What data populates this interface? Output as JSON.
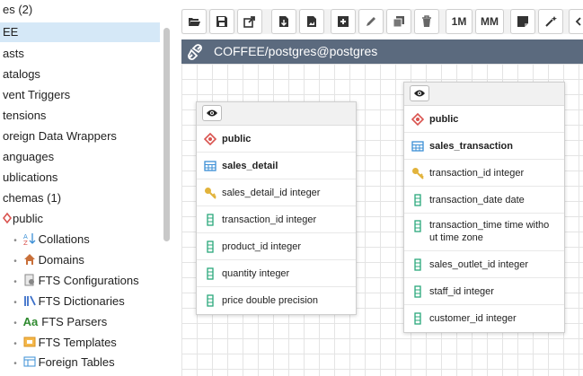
{
  "sidebar": {
    "items": [
      {
        "label": "es (2)",
        "icon": "none",
        "selected": false
      },
      {
        "label": "EE",
        "icon": "none",
        "selected": true
      },
      {
        "label": "asts",
        "icon": "none",
        "selected": false
      },
      {
        "label": "atalogs",
        "icon": "none",
        "selected": false
      },
      {
        "label": "vent Triggers",
        "icon": "none",
        "selected": false
      },
      {
        "label": "tensions",
        "icon": "none",
        "selected": false
      },
      {
        "label": "oreign Data Wrappers",
        "icon": "none",
        "selected": false
      },
      {
        "label": "anguages",
        "icon": "none",
        "selected": false
      },
      {
        "label": "ublications",
        "icon": "none",
        "selected": false
      },
      {
        "label": "chemas (1)",
        "icon": "none",
        "selected": false
      },
      {
        "label": "public",
        "icon": "schema-icon",
        "selected": false
      },
      {
        "label": "Collations",
        "icon": "collation-icon",
        "selected": false
      },
      {
        "label": "Domains",
        "icon": "domain-icon",
        "selected": false
      },
      {
        "label": "FTS Configurations",
        "icon": "fts-config-icon",
        "selected": false
      },
      {
        "label": "FTS Dictionaries",
        "icon": "fts-dictionary-icon",
        "selected": false
      },
      {
        "label": "FTS Parsers",
        "icon": "fts-parser-icon",
        "selected": false
      },
      {
        "label": "FTS Templates",
        "icon": "fts-template-icon",
        "selected": false
      },
      {
        "label": "Foreign Tables",
        "icon": "foreign-table-icon",
        "selected": false
      }
    ],
    "fts_parser_prefix": "Aa"
  },
  "toolbar": {
    "buttons": [
      {
        "name": "open-file-button",
        "icon": "folder-open-icon"
      },
      {
        "name": "save-button",
        "icon": "save-icon"
      },
      {
        "name": "save-as-button",
        "icon": "save-as-icon"
      },
      {
        "name": "export-sql-button",
        "icon": "export-sql-icon"
      },
      {
        "name": "download-image-button",
        "icon": "download-image-icon"
      },
      {
        "name": "add-table-button",
        "icon": "add-table-icon"
      },
      {
        "name": "edit-table-button",
        "icon": "pencil-icon"
      },
      {
        "name": "clone-table-button",
        "icon": "clone-icon"
      },
      {
        "name": "delete-button",
        "icon": "trash-icon"
      },
      {
        "name": "one-to-many-button",
        "label": "1M"
      },
      {
        "name": "many-to-many-button",
        "label": "MM"
      },
      {
        "name": "add-note-button",
        "icon": "note-icon"
      },
      {
        "name": "auto-align-button",
        "icon": "magic-wand-icon"
      }
    ]
  },
  "canvas": {
    "title": "COFFEE/postgres@postgres",
    "header_color": "#5b6a7e",
    "tables": [
      {
        "schema": "public",
        "name": "sales_detail",
        "columns": [
          {
            "text": "sales_detail_id integer",
            "key": "primary"
          },
          {
            "text": "transaction_id integer",
            "key": "none"
          },
          {
            "text": "product_id integer",
            "key": "none"
          },
          {
            "text": "quantity integer",
            "key": "none"
          },
          {
            "text": "price double precision",
            "key": "none"
          }
        ]
      },
      {
        "schema": "public",
        "name": "sales_transaction",
        "columns": [
          {
            "text": "transaction_id integer",
            "key": "primary"
          },
          {
            "text": "transaction_date date",
            "key": "none"
          },
          {
            "text": "transaction_time time witho ut time zone",
            "key": "none"
          },
          {
            "text": "sales_outlet_id integer",
            "key": "none"
          },
          {
            "text": "staff_id integer",
            "key": "none"
          },
          {
            "text": "customer_id integer",
            "key": "none"
          }
        ]
      }
    ]
  },
  "colors": {
    "selected_row": "#d5e8f7",
    "schema_icon": "#d9534f",
    "table_icon": "#3b8fd6",
    "column_icon": "#2aa87b",
    "primary_key_icon": "#e2b33b"
  }
}
